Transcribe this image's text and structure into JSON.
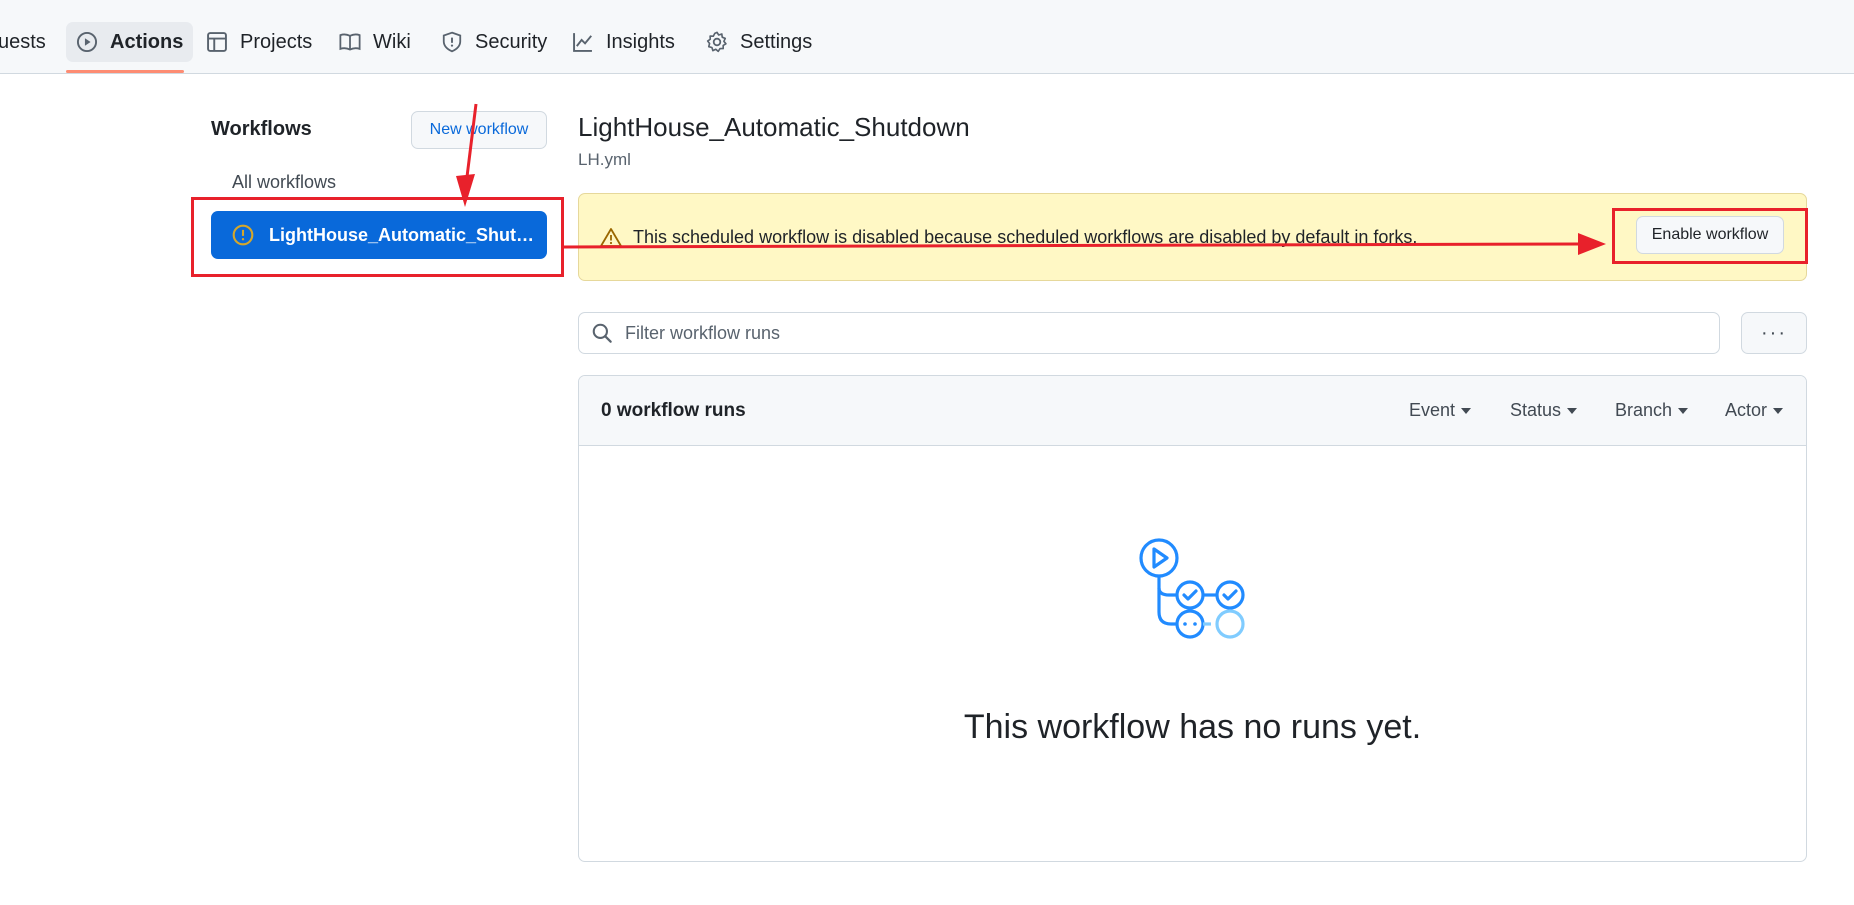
{
  "tabs": [
    {
      "label": "uests",
      "icon": "pull-request-icon"
    },
    {
      "label": "Actions",
      "icon": "play-icon"
    },
    {
      "label": "Projects",
      "icon": "table-icon"
    },
    {
      "label": "Wiki",
      "icon": "book-icon"
    },
    {
      "label": "Security",
      "icon": "shield-icon"
    },
    {
      "label": "Insights",
      "icon": "graph-icon"
    },
    {
      "label": "Settings",
      "icon": "gear-icon"
    }
  ],
  "sidebar": {
    "title": "Workflows",
    "new_workflow_label": "New workflow",
    "all_workflows_label": "All workflows",
    "selected_workflow": "LightHouse_Automatic_Shutdown"
  },
  "main": {
    "workflow_title": "LightHouse_Automatic_Shutdown",
    "workflow_file": "LH.yml",
    "banner_message": "This scheduled workflow is disabled because scheduled workflows are disabled by default in forks.",
    "enable_button_label": "Enable workflow",
    "filter_placeholder": "Filter workflow runs",
    "more_label": "···",
    "runs_count": "0 workflow runs",
    "filters": [
      "Event",
      "Status",
      "Branch",
      "Actor"
    ],
    "empty_message": "This workflow has no runs yet."
  },
  "colors": {
    "accent": "#0969da",
    "annotation_red": "#e8212b",
    "banner_bg": "#fff8c5",
    "tab_underline": "#fd8c73"
  }
}
